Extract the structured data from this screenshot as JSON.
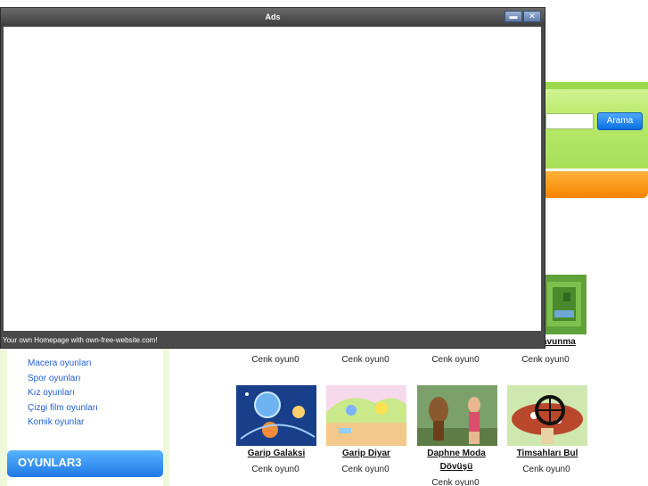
{
  "ads_window": {
    "title": "Ads",
    "footer_link": "Your own Homepage with own-free-website.com!"
  },
  "search": {
    "button_label": "Arama",
    "placeholder": ""
  },
  "sidebar": {
    "categories": [
      "Macera oyunları",
      "Spor oyunları",
      "Kız oyunları",
      "Çizgi film oyunları",
      "Komik oyunlar"
    ],
    "section_button": "OYUNLAR3"
  },
  "games_row1": {
    "partial_title": "avunma",
    "authors": [
      "Cenk oyun0",
      "Cenk oyun0",
      "Cenk oyun0",
      "Cenk oyun0"
    ]
  },
  "games_row2": [
    {
      "title": "Garip Galaksi",
      "author": "Cenk oyun0",
      "thumb_icon": "galaxy-thumbnail"
    },
    {
      "title": "Garip Diyar",
      "author": "Cenk oyun0",
      "thumb_icon": "strange-land-thumbnail"
    },
    {
      "title": "Daphne Moda Dövüşü",
      "author": "Cenk oyun0",
      "thumb_icon": "fashion-fight-thumbnail"
    },
    {
      "title": "Timsahları Bul",
      "author": "Cenk oyun0",
      "thumb_icon": "crocodile-search-thumbnail"
    }
  ],
  "colors": {
    "header_green": "#b8ea6a",
    "orange_bar": "#f58400",
    "accent_blue": "#1f78e6",
    "popup_chrome": "#4a4a4a"
  }
}
